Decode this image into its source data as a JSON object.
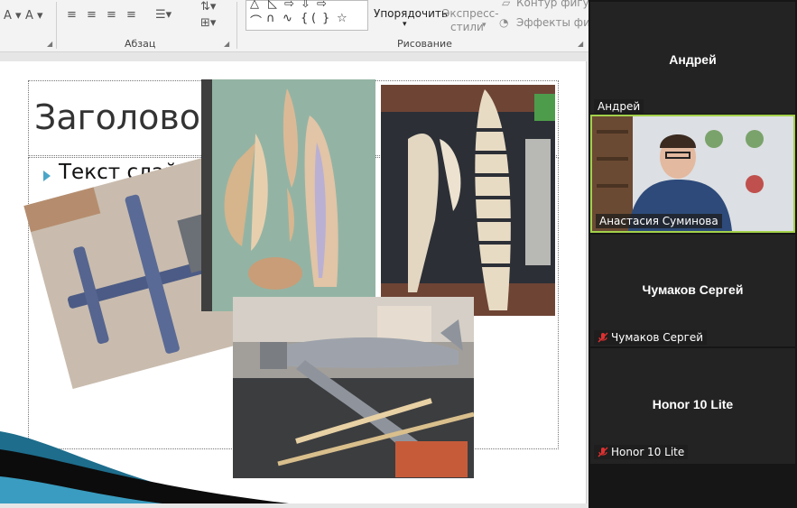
{
  "ribbon": {
    "paragraph_group_label": "Абзац",
    "drawing_group_label": "Рисование",
    "arrange_label": "Упорядочить",
    "quick_styles_label_1": "Экспресс-",
    "quick_styles_label_2": "стили",
    "shape_outline_label": "Контур фигуры",
    "shape_effects_label": "Эффекты фигур"
  },
  "slide": {
    "title": "Заголовок слайда",
    "bullet": "Текст слайда"
  },
  "video_panel": {
    "tiles": [
      {
        "display_name": "Андрей",
        "tag": ""
      },
      {
        "display_name": "",
        "tag": "Анастасия Суминова",
        "top_label": "Андрей"
      },
      {
        "display_name": "Чумаков Сергей",
        "tag": "Чумаков Сергей"
      },
      {
        "display_name": "Honor 10 Lite",
        "tag": "Honor 10 Lite"
      }
    ]
  },
  "colors": {
    "ribbon_bg": "#f3f3f3",
    "active_speaker_border": "#a3d14a",
    "bullet_accent": "#4aa6c8",
    "mute_red": "#e03030",
    "panel_bg": "#161616"
  }
}
